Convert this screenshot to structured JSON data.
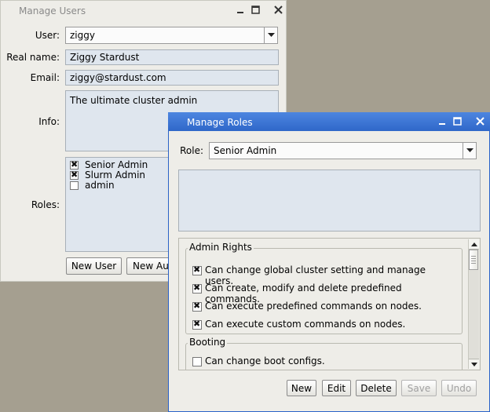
{
  "manage_users": {
    "title": "Manage Users",
    "user_label": "User:",
    "user_value": "ziggy",
    "realname_label": "Real name:",
    "realname_value": "Ziggy Stardust",
    "email_label": "Email:",
    "email_value": "ziggy@stardust.com",
    "info_label": "Info:",
    "info_value": "The ultimate cluster admin",
    "roles_label": "Roles:",
    "roles": [
      {
        "label": "Senior Admin",
        "checked": true
      },
      {
        "label": "Slurm Admin",
        "checked": true
      },
      {
        "label": "admin",
        "checked": false
      }
    ],
    "new_user_button": "New User",
    "new_auth_button": "New Aut"
  },
  "manage_roles": {
    "title": "Manage Roles",
    "role_label": "Role:",
    "role_value": "Senior Admin",
    "groups": [
      {
        "title": "Admin Rights",
        "items": [
          {
            "label": "Can change global cluster setting and manage users.",
            "checked": true
          },
          {
            "label": "Can create, modify and delete predefined commands.",
            "checked": true
          },
          {
            "label": "Can execute predefined commands on nodes.",
            "checked": true
          },
          {
            "label": "Can execute custom commands on nodes.",
            "checked": true
          }
        ]
      },
      {
        "title": "Booting",
        "items": [
          {
            "label": "Can change boot configs.",
            "checked": false
          }
        ]
      }
    ],
    "buttons": {
      "new": "New",
      "edit": "Edit",
      "delete": "Delete",
      "save": "Save",
      "undo": "Undo"
    }
  },
  "colors": {
    "desktop": "#a59f90",
    "window_bg": "#eeede8",
    "active_border": "#2a62c8",
    "field_bg": "#dfe6ee"
  }
}
